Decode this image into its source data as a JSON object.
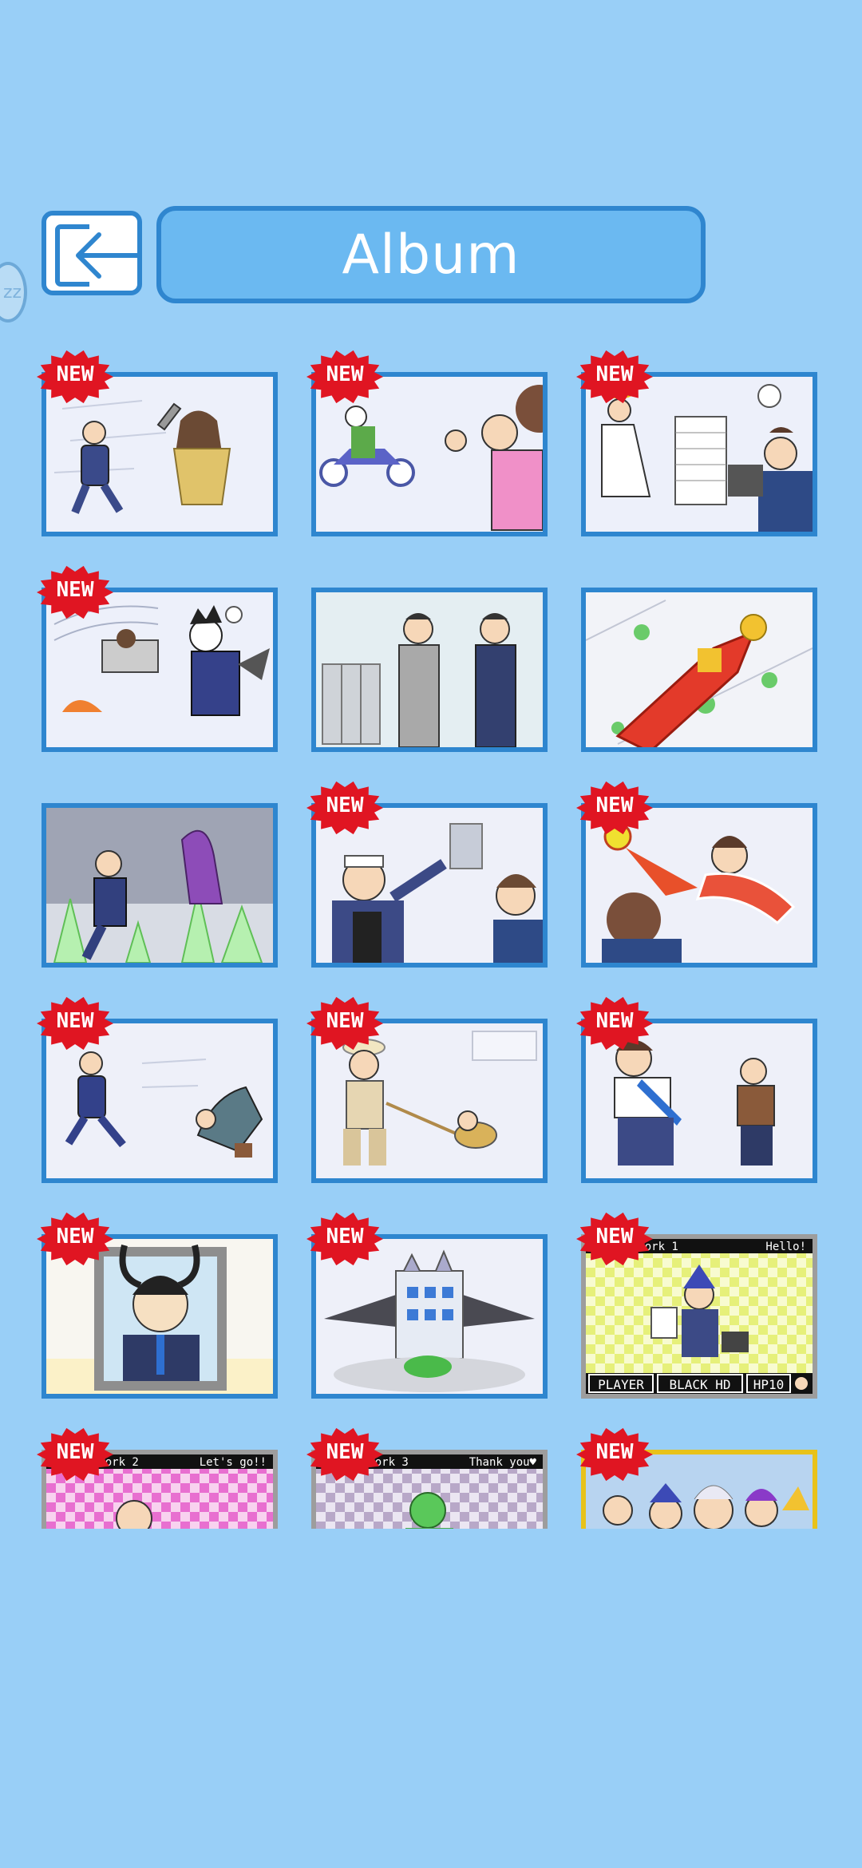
{
  "header": {
    "back_icon": "exit-arrow-icon",
    "title": "Album"
  },
  "sleep_indicator": {
    "text": "zz",
    "icon": "sleep-icon"
  },
  "new_badge_label": "NEW",
  "album_cards": [
    {
      "is_new": true
    },
    {
      "is_new": true
    },
    {
      "is_new": true
    },
    {
      "is_new": true
    },
    {
      "is_new": false
    },
    {
      "is_new": false
    },
    {
      "is_new": false
    },
    {
      "is_new": true
    },
    {
      "is_new": true
    },
    {
      "is_new": true
    },
    {
      "is_new": true
    },
    {
      "is_new": true
    },
    {
      "is_new": true
    },
    {
      "is_new": true
    },
    {
      "is_new": true,
      "overlay": {
        "top_left": "ng Work 1",
        "top_right": "Hello!",
        "bottom": [
          "PLAYER",
          "BLACK HD",
          "HP10"
        ]
      }
    },
    {
      "is_new": true,
      "overlay": {
        "top_left": "ng Work 2",
        "top_right": "Let's go!!"
      }
    },
    {
      "is_new": true,
      "overlay": {
        "top_left": "ng Work 3",
        "top_right": "Thank you♥"
      }
    },
    {
      "is_new": true
    }
  ],
  "colors": {
    "background": "#99cff7",
    "card_border": "#2e86cf",
    "badge_red": "#e01522"
  }
}
